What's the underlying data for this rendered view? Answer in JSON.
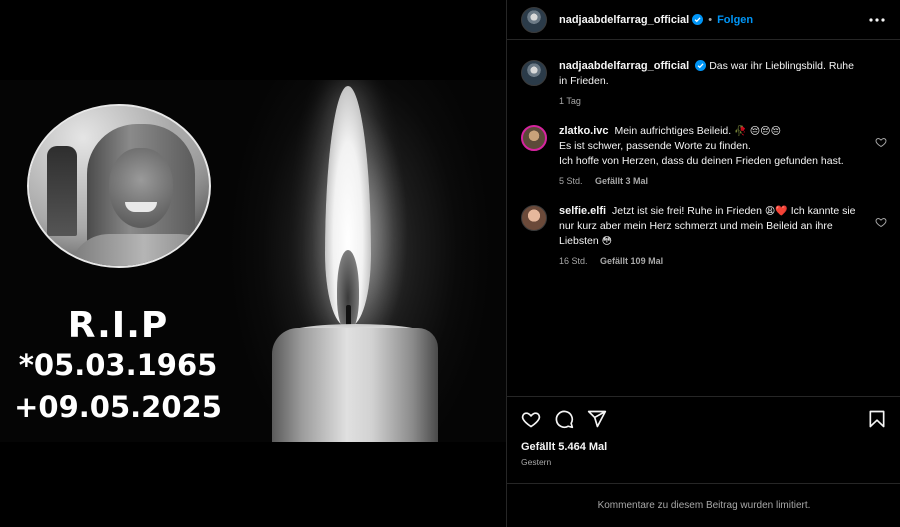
{
  "post": {
    "image": {
      "rip_title": "R.I.P",
      "birth": "*05.03.1965",
      "death": "+09.05.2025"
    }
  },
  "header": {
    "username": "nadjaabdelfarrag_official",
    "separator": "•",
    "follow_label": "Folgen"
  },
  "caption": {
    "username": "nadjaabdelfarrag_official",
    "text": "Das war ihr Lieblingsbild. Ruhe in Frieden.",
    "time": "1 Tag"
  },
  "comments": [
    {
      "username": "zlatko.ivc",
      "line1": "Mein aufrichtiges Beileid.",
      "emoji1": "🥀 😔😔😔",
      "line2": "Es ist schwer, passende Worte zu finden.",
      "line3": "Ich hoffe von Herzen, dass du deinen Frieden gefunden hast.",
      "time": "5 Std.",
      "likes": "Gefällt 3 Mal"
    },
    {
      "username": "selfie.elfi",
      "text1": "Jetzt ist sie frei! Ruhe in Frieden",
      "emoji1": "😩❤️",
      "text2": "Ich kannte sie nur kurz aber mein Herz schmerzt und mein Beileid an ihre Liebsten",
      "emoji2": "😳",
      "time": "16 Std.",
      "likes": "Gefällt 109 Mal"
    }
  ],
  "footer": {
    "likes": "Gefällt 5.464 Mal",
    "date": "Gestern",
    "limited_text": "Kommentare zu diesem Beitrag wurden limitiert."
  },
  "icons": {
    "like": "heart-icon",
    "comment": "comment-icon",
    "share": "share-icon",
    "save": "bookmark-icon",
    "more": "more-horizontal-icon",
    "verified": "verified-badge-icon"
  },
  "colors": {
    "accent": "#0095f6",
    "background": "#000000",
    "muted": "#a8a8a8",
    "border": "#262626"
  }
}
